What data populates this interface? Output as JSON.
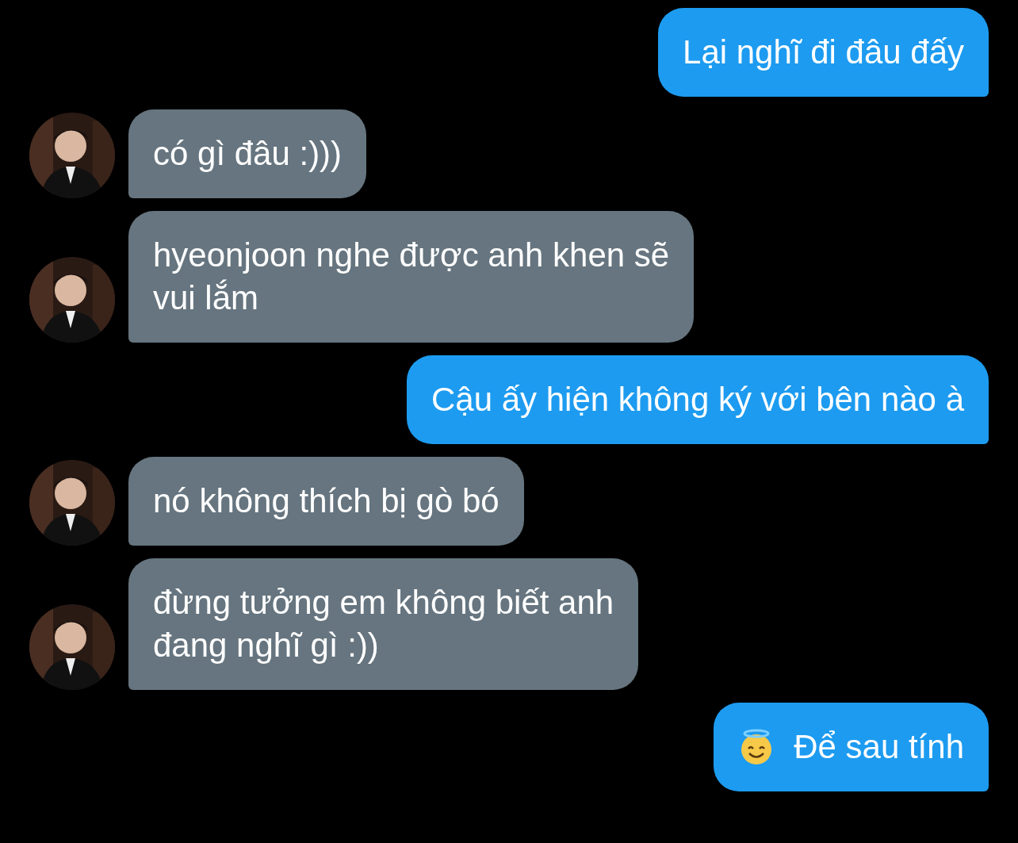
{
  "messages": [
    {
      "sent": true,
      "kind": "text",
      "text": "Lại nghĩ đi đâu đấy"
    },
    {
      "sent": false,
      "kind": "text",
      "text": "có gì đâu :)))"
    },
    {
      "sent": false,
      "kind": "text",
      "text": "hyeonjoon nghe được anh khen sẽ\nvui lắm"
    },
    {
      "sent": true,
      "kind": "text",
      "text": "Cậu ấy hiện không ký với bên nào à"
    },
    {
      "sent": false,
      "kind": "text",
      "text": "nó không thích bị gò bó"
    },
    {
      "sent": false,
      "kind": "text",
      "text": "đừng tưởng em không biết anh\nđang nghĩ gì :))"
    },
    {
      "sent": true,
      "kind": "emoji_text",
      "text": "Để sau tính"
    }
  ]
}
